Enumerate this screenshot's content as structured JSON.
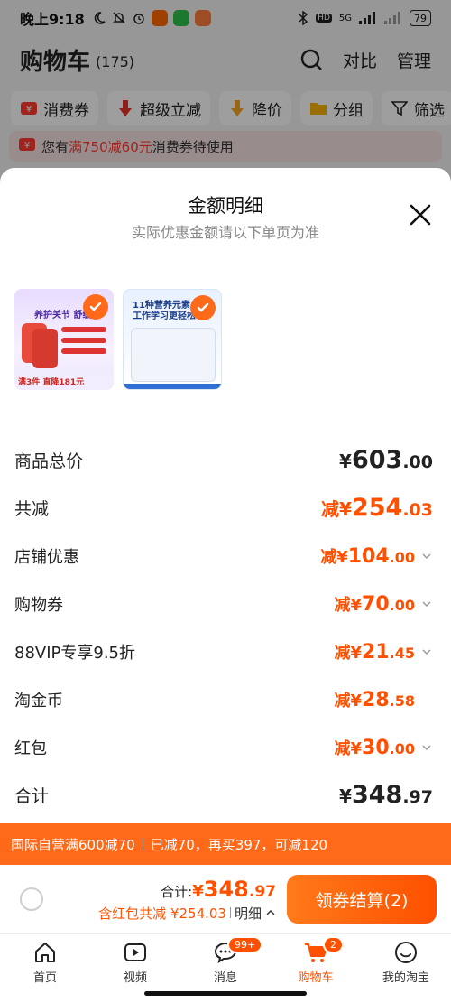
{
  "status_bar": {
    "time": "晚上9:18",
    "network": "5G",
    "hd": "HD",
    "battery": "79"
  },
  "cart": {
    "title": "购物车",
    "count": "(175)",
    "compare": "对比",
    "manage": "管理"
  },
  "chips": [
    {
      "label": "消费券",
      "icon": "coupon-icon"
    },
    {
      "label": "超级立减",
      "icon": "arrow-down-icon"
    },
    {
      "label": "降价",
      "icon": "price-drop-icon"
    },
    {
      "label": "分组",
      "icon": "folder-icon"
    },
    {
      "label": "筛选",
      "icon": "filter-icon"
    }
  ],
  "coupon_banner": {
    "prefix": "您有",
    "highlight": "满750减60元",
    "suffix": "消费券待使用"
  },
  "sheet": {
    "title": "金额明细",
    "subtitle": "实际优惠金额请以下单页为准",
    "thumbs": [
      {
        "headline": "养护关节 舒缓",
        "footer": "满3件 直降181元"
      },
      {
        "headline": "11种营养元素\n工作学习更轻松"
      }
    ],
    "rows": [
      {
        "label": "商品总价",
        "prefix": "¥",
        "int": "603",
        "dec": ".00",
        "dropdown": false
      },
      {
        "label": "共减",
        "prefix": "减¥",
        "int": "254",
        "dec": ".03",
        "dropdown": false
      },
      {
        "label": "店铺优惠",
        "prefix": "减¥",
        "int": "104",
        "dec": ".00",
        "dropdown": true
      },
      {
        "label": "购物券",
        "prefix": "减¥",
        "int": "70",
        "dec": ".00",
        "dropdown": true
      },
      {
        "label": "88VIP专享9.5折",
        "prefix": "减¥",
        "int": "21",
        "dec": ".45",
        "dropdown": true
      },
      {
        "label": "淘金币",
        "prefix": "减¥",
        "int": "28",
        "dec": ".58",
        "dropdown": false
      },
      {
        "label": "红包",
        "prefix": "减¥",
        "int": "30",
        "dec": ".00",
        "dropdown": true
      },
      {
        "label": "合计",
        "prefix": "¥",
        "int": "348",
        "dec": ".97",
        "dropdown": false
      }
    ]
  },
  "promo": {
    "part1": "国际自营满600减70",
    "part2": "已减70，再买397，可减120"
  },
  "checkout": {
    "total_label": "合计:",
    "total_prefix": "¥",
    "total_int": "348",
    "total_dec": ".97",
    "detail": "含红包共减 ¥254.03",
    "detail_link": "明细",
    "pay_button": "领券结算(2)"
  },
  "tabs": [
    {
      "label": "首页",
      "icon": "home-icon"
    },
    {
      "label": "视频",
      "icon": "video-icon"
    },
    {
      "label": "消息",
      "icon": "message-icon",
      "badge": "99+"
    },
    {
      "label": "购物车",
      "icon": "cart-icon",
      "badge": "2"
    },
    {
      "label": "我的淘宝",
      "icon": "profile-icon"
    }
  ],
  "colors": {
    "accent": "#ff5000",
    "promo_bg": "#ff6a1a"
  }
}
